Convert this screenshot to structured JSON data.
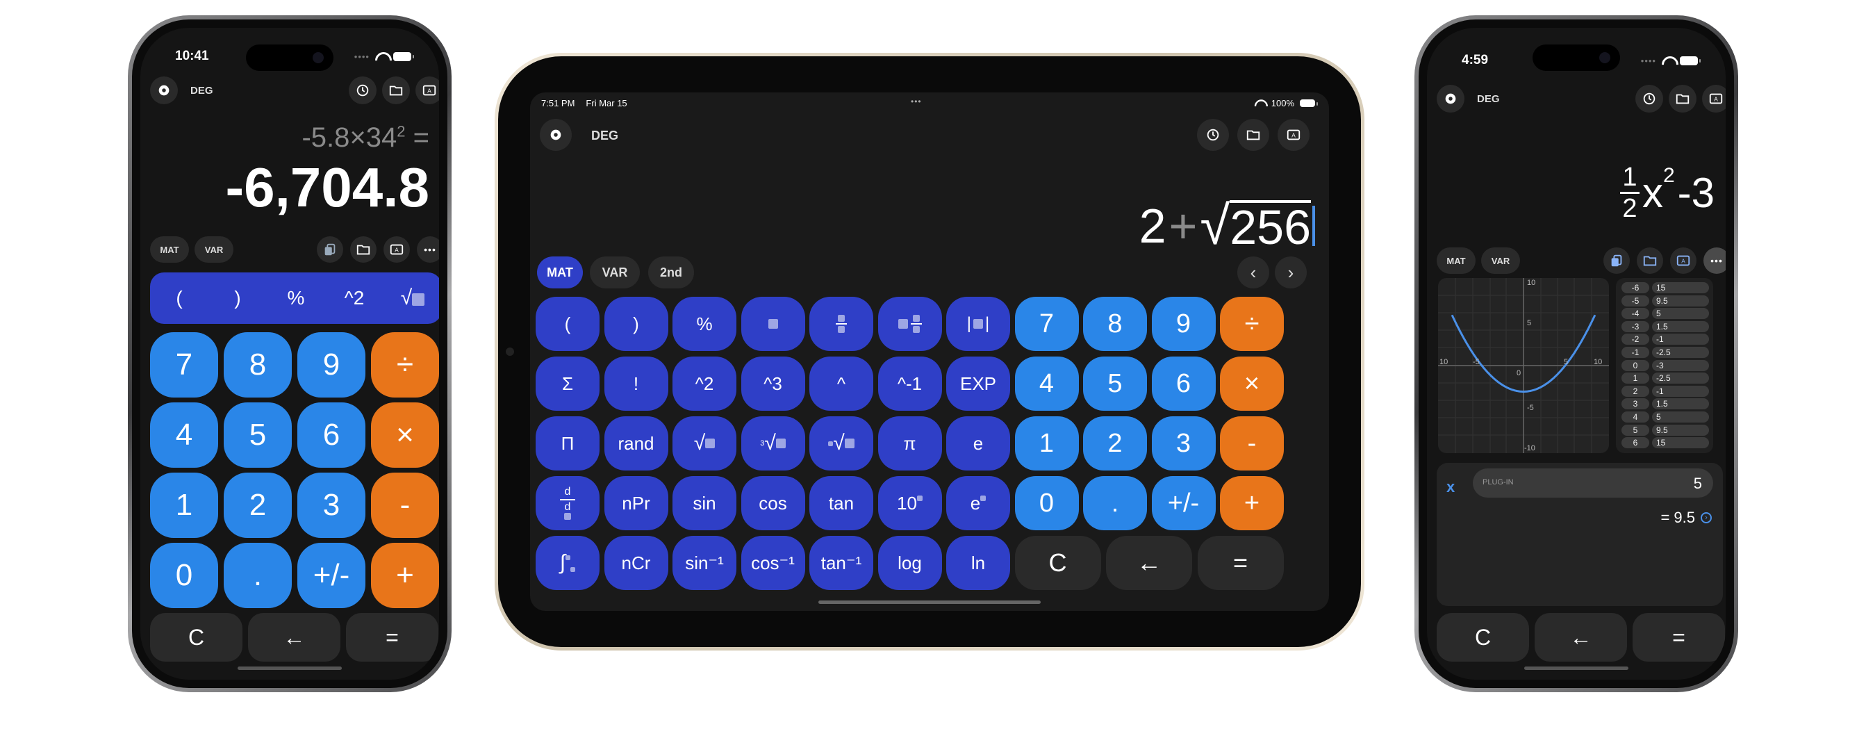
{
  "phone1": {
    "time": "10:41",
    "mode": "DEG",
    "expression": "-5.8×34",
    "expression_exp": "2",
    "expression_eq": "=",
    "result": "-6,704.8",
    "pills": [
      "MAT",
      "VAR"
    ],
    "fn_keys": [
      "(",
      ")",
      "%",
      "^2"
    ],
    "keypad": [
      [
        "7",
        "8",
        "9",
        "÷"
      ],
      [
        "4",
        "5",
        "6",
        "×"
      ],
      [
        "1",
        "2",
        "3",
        "-"
      ],
      [
        "0",
        ".",
        "+/-",
        "+"
      ]
    ],
    "bottom_keys": [
      "C",
      "←",
      "="
    ]
  },
  "tablet": {
    "time": "7:51 PM",
    "date": "Fri Mar 15",
    "menu_dots": "•••",
    "battery": "100%",
    "mode": "DEG",
    "expression_a": "2",
    "expression_op": "+",
    "expression_b": "256",
    "pills": [
      "MAT",
      "VAR",
      "2nd"
    ],
    "rows": [
      [
        "(",
        ")",
        "%",
        "■",
        "frac",
        "mixfrac",
        "|■|",
        "7",
        "8",
        "9",
        "÷"
      ],
      [
        "Σ",
        "!",
        "^2",
        "^3",
        "^",
        "^-1",
        "EXP",
        "4",
        "5",
        "6",
        "×"
      ],
      [
        "Π",
        "rand",
        "sqrt",
        "cbrt",
        "nroot",
        "π",
        "e",
        "1",
        "2",
        "3",
        "-"
      ],
      [
        "d/dx",
        "nPr",
        "sin",
        "cos",
        "tan",
        "10■",
        "e■",
        "0",
        ".",
        "+/-",
        "+"
      ],
      [
        "∫",
        "nCr",
        "sin⁻¹",
        "cos⁻¹",
        "tan⁻¹",
        "log",
        "ln",
        "C",
        "←",
        "="
      ]
    ]
  },
  "phone2": {
    "time": "4:59",
    "mode": "DEG",
    "expression_num": "1",
    "expression_den": "2",
    "expression_var": "x",
    "expression_exp": "2",
    "expression_tail": "-3",
    "pills": [
      "MAT",
      "VAR"
    ],
    "graph": {
      "y_top": "10",
      "y_mid": "5",
      "y_zero": "0",
      "y_neg5": "-5",
      "y_bottom": "-10",
      "x_left": "10",
      "x_neg5": "-5",
      "x_pos5": "5",
      "x_right": "10"
    },
    "table": [
      [
        "-6",
        "15"
      ],
      [
        "-5",
        "9.5"
      ],
      [
        "-4",
        "5"
      ],
      [
        "-3",
        "1.5"
      ],
      [
        "-2",
        "-1"
      ],
      [
        "-1",
        "-2.5"
      ],
      [
        "0",
        "-3"
      ],
      [
        "1",
        "-2.5"
      ],
      [
        "2",
        "-1"
      ],
      [
        "3",
        "1.5"
      ],
      [
        "4",
        "5"
      ],
      [
        "5",
        "9.5"
      ],
      [
        "6",
        "15"
      ]
    ],
    "plug_var": "x",
    "plug_placeholder": "PLUG-IN",
    "plug_value": "5",
    "plug_result": "= 9.5",
    "bottom_keys": [
      "C",
      "←",
      "="
    ]
  },
  "colors": {
    "blue_key": "#2a86e8",
    "orange_key": "#e8751a",
    "fn_key": "#2f3fc7",
    "dark_key": "#2a2a2a",
    "curve": "#4a90e8"
  }
}
